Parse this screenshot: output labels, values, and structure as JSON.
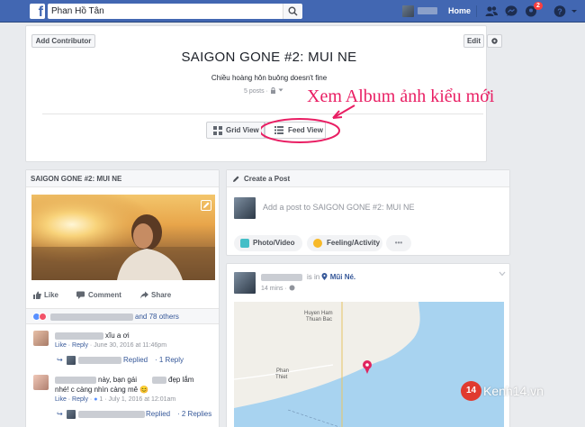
{
  "topbar": {
    "logo": "f",
    "search_value": "Phan Hồ Tân",
    "home_label": "Home",
    "notification_count": "2"
  },
  "album": {
    "add_contributor": "Add Contributor",
    "edit": "Edit",
    "title": "SAIGON GONE #2: MUI NE",
    "subtitle": "Chiều hoàng hôn buông doesn't fine",
    "meta": "5 posts",
    "grid_view": "Grid View",
    "feed_view": "Feed View",
    "callout": "Xem Album ảnh kiểu mới"
  },
  "left_card": {
    "header": "SAIGON GONE #2: MUI NE",
    "actions": {
      "like": "Like",
      "comment": "Comment",
      "share": "Share"
    },
    "reactions_text": "and 78 others",
    "comments": [
      {
        "text": "xĩu a ơi",
        "actions": "Like · Reply",
        "time": "· June 30, 2016 at 11:46pm",
        "reply_label": "Replied",
        "reply_count": "· 1 Reply"
      },
      {
        "text": "này, bạn gái",
        "text2": "đẹp lắm",
        "text3": "nhé! c càng nhìn càng mê 😊",
        "actions": "Like · Reply",
        "likes": "1",
        "time": "· July 1, 2016 at 12:01am",
        "reply_label": "Replied",
        "reply_count": "· 2 Replies"
      }
    ]
  },
  "create_post": {
    "header": "Create a Post",
    "placeholder": "Add a post to SAIGON GONE #2: MUI NE",
    "photo_video": "Photo/Video",
    "feeling": "Feeling/Activity",
    "more": "•••"
  },
  "feed_post": {
    "is_in": "is in",
    "location": "Mũi Né.",
    "time": "14 mins ·",
    "map_labels": {
      "huyen_ham": "Huyen Ham",
      "thuan_bac": "Thuan Bac",
      "phan": "Phan",
      "thiet": "Thiet"
    }
  },
  "watermark": {
    "badge": "14",
    "text": "Kenh14.vn"
  },
  "colors": {
    "fb_blue": "#4267b2",
    "link": "#365899",
    "callout": "#e91e63",
    "map_water": "#a8d3f0"
  }
}
